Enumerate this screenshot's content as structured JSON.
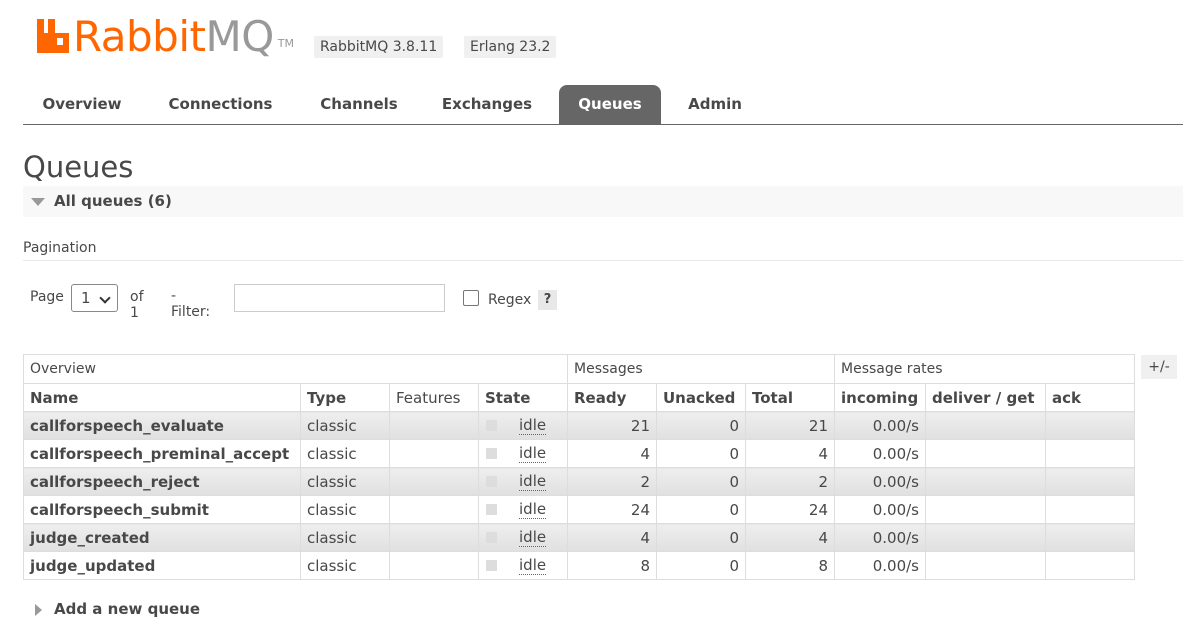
{
  "header": {
    "logo_brand": "Rabbit",
    "logo_product": "MQ",
    "logo_tm": "TM",
    "version": "RabbitMQ 3.8.11",
    "erlang": "Erlang 23.2",
    "brand_color": "#ff6600"
  },
  "tabs": [
    {
      "label": "Overview",
      "active": false
    },
    {
      "label": "Connections",
      "active": false
    },
    {
      "label": "Channels",
      "active": false
    },
    {
      "label": "Exchanges",
      "active": false
    },
    {
      "label": "Queues",
      "active": true
    },
    {
      "label": "Admin",
      "active": false
    }
  ],
  "page_title": "Queues",
  "section": {
    "label": "All queues (6)"
  },
  "pagination": {
    "title": "Pagination",
    "page_label": "Page",
    "page_value": "1",
    "of_label": "of 1",
    "filter_label": "- Filter:",
    "filter_value": "",
    "regex_label": "Regex",
    "help_label": "?"
  },
  "table": {
    "groups": [
      "Overview",
      "Messages",
      "Message rates"
    ],
    "columns": [
      "Name",
      "Type",
      "Features",
      "State",
      "Ready",
      "Unacked",
      "Total",
      "incoming",
      "deliver / get",
      "ack"
    ],
    "toggle_label": "+/-",
    "rows": [
      {
        "name": "callforspeech_evaluate",
        "type": "classic",
        "features": "",
        "state": "idle",
        "ready": "21",
        "unacked": "0",
        "total": "21",
        "incoming": "0.00/s",
        "deliver": "",
        "ack": ""
      },
      {
        "name": "callforspeech_preminal_accept",
        "type": "classic",
        "features": "",
        "state": "idle",
        "ready": "4",
        "unacked": "0",
        "total": "4",
        "incoming": "0.00/s",
        "deliver": "",
        "ack": ""
      },
      {
        "name": "callforspeech_reject",
        "type": "classic",
        "features": "",
        "state": "idle",
        "ready": "2",
        "unacked": "0",
        "total": "2",
        "incoming": "0.00/s",
        "deliver": "",
        "ack": ""
      },
      {
        "name": "callforspeech_submit",
        "type": "classic",
        "features": "",
        "state": "idle",
        "ready": "24",
        "unacked": "0",
        "total": "24",
        "incoming": "0.00/s",
        "deliver": "",
        "ack": ""
      },
      {
        "name": "judge_created",
        "type": "classic",
        "features": "",
        "state": "idle",
        "ready": "4",
        "unacked": "0",
        "total": "4",
        "incoming": "0.00/s",
        "deliver": "",
        "ack": ""
      },
      {
        "name": "judge_updated",
        "type": "classic",
        "features": "",
        "state": "idle",
        "ready": "8",
        "unacked": "0",
        "total": "8",
        "incoming": "0.00/s",
        "deliver": "",
        "ack": ""
      }
    ]
  },
  "add_queue": {
    "label": "Add a new queue"
  }
}
